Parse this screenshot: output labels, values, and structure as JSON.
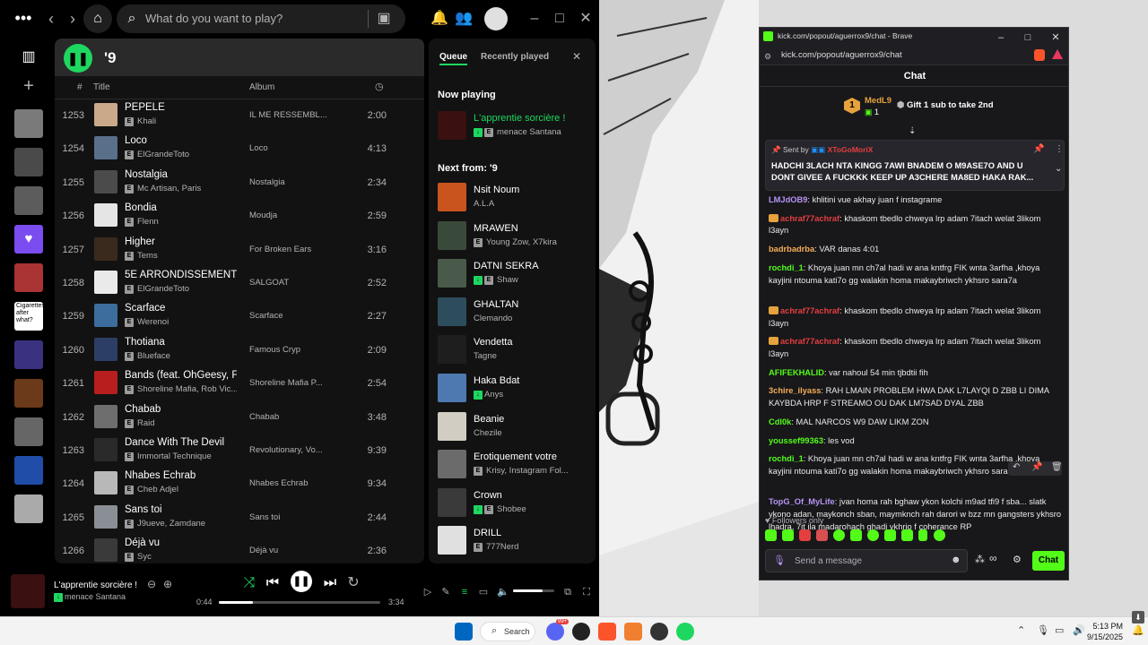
{
  "spotify": {
    "search_placeholder": "What do you want to play?",
    "playlist_title": "'9",
    "columns": {
      "num": "#",
      "title": "Title",
      "album": "Album"
    },
    "library_text_cover": "Cigarettes after what?",
    "tracks": [
      {
        "num": "1253",
        "title": "PEPELE",
        "artist": "Khali",
        "album": "IL ME RESSEMBL...",
        "dur": "2:00",
        "color": "#c9a98a"
      },
      {
        "num": "1254",
        "title": "Loco",
        "artist": "ElGrandeToto",
        "album": "Loco",
        "dur": "4:13",
        "color": "#5a6f8a"
      },
      {
        "num": "1255",
        "title": "Nostalgia",
        "artist": "Mc Artisan, Paris",
        "album": "Nostalgia",
        "dur": "2:34",
        "color": "#4b4b4b"
      },
      {
        "num": "1256",
        "title": "Bondia",
        "artist": "Flenn",
        "album": "Moudja",
        "dur": "2:59",
        "color": "#e5e5e5"
      },
      {
        "num": "1257",
        "title": "Higher",
        "artist": "Tems",
        "album": "For Broken Ears",
        "dur": "3:16",
        "color": "#3a2a1e"
      },
      {
        "num": "1258",
        "title": "5E ARRONDISSEMENT",
        "artist": "ElGrandeToto",
        "album": "SALGOAT",
        "dur": "2:52",
        "color": "#eaeaea"
      },
      {
        "num": "1259",
        "title": "Scarface",
        "artist": "Werenoi",
        "album": "Scarface",
        "dur": "2:27",
        "color": "#3c6d9c"
      },
      {
        "num": "1260",
        "title": "Thotiana",
        "artist": "Blueface",
        "album": "Famous Cryp",
        "dur": "2:09",
        "color": "#2c3e66"
      },
      {
        "num": "1261",
        "title": "Bands (feat. OhGeesy, F...",
        "artist": "Shoreline Mafia, Rob Vic...",
        "album": "Shoreline Mafia P...",
        "dur": "2:54",
        "color": "#b71f1f"
      },
      {
        "num": "1262",
        "title": "Chabab",
        "artist": "Raid",
        "album": "Chabab",
        "dur": "3:48",
        "color": "#6e6e6e"
      },
      {
        "num": "1263",
        "title": "Dance With The Devil",
        "artist": "Immortal Technique",
        "album": "Revolutionary, Vo...",
        "dur": "9:39",
        "color": "#2a2a2a"
      },
      {
        "num": "1264",
        "title": "Nhabes Echrab",
        "artist": "Cheb Adjel",
        "album": "Nhabes Echrab",
        "dur": "9:34",
        "color": "#b8b8b8"
      },
      {
        "num": "1265",
        "title": "Sans toi",
        "artist": "J9ueve, Zamdane",
        "album": "Sans toi",
        "dur": "2:44",
        "color": "#8a8f96"
      },
      {
        "num": "1266",
        "title": "Déjà vu",
        "artist": "Syc",
        "album": "Déjà vu",
        "dur": "2:36",
        "color": "#3a3a3a"
      }
    ],
    "queue": {
      "tab_queue": "Queue",
      "tab_recent": "Recently played",
      "now_playing_label": "Now playing",
      "now": {
        "title": "L'apprentie sorcière !",
        "artist": "menace Santana"
      },
      "next_label": "Next from: '9",
      "items": [
        {
          "title": "Nsit Noum",
          "artist": "A.L.A",
          "badge": "",
          "color": "#c9541d"
        },
        {
          "title": "MRAWEN",
          "artist": "Young Zow, X7kira",
          "badge": "E",
          "color": "#3a4a3a"
        },
        {
          "title": "DATNI SEKRA",
          "artist": "Shaw",
          "badge": "GE",
          "color": "#4a5a4a"
        },
        {
          "title": "GHALTAN",
          "artist": "Clemando",
          "badge": "",
          "color": "#2d4d5d"
        },
        {
          "title": "Vendetta",
          "artist": "Tagne",
          "badge": "",
          "color": "#1e1e1e"
        },
        {
          "title": "Haka Bdat",
          "artist": "Anys",
          "badge": "G",
          "color": "#4d79b0"
        },
        {
          "title": "Beanie",
          "artist": "Chezile",
          "badge": "",
          "color": "#d2cdc2"
        },
        {
          "title": "Erotiquement votre",
          "artist": "Krisy, Instagram Fol...",
          "badge": "E",
          "color": "#6b6b6b"
        },
        {
          "title": "Crown",
          "artist": "Shobee",
          "badge": "GE",
          "color": "#3a3a3a"
        },
        {
          "title": "DRILL",
          "artist": "777Nerd",
          "badge": "E",
          "color": "#e0e0e0"
        }
      ]
    },
    "player": {
      "title": "L'apprentie sorcière !",
      "artist": "menace Santana",
      "elapsed": "0:44",
      "total": "3:34",
      "progress": 0.21,
      "volume": 0.72
    }
  },
  "kick": {
    "window_title": "kick.com/popout/aguerrox9/chat - Brave",
    "url": "kick.com/popout/aguerrox9/chat",
    "chat_header": "Chat",
    "gift": {
      "rank": "1",
      "user": "MedL9",
      "count": "1",
      "label": "Gift 1 sub to take 2nd"
    },
    "pinned": {
      "sent_by": "Sent by",
      "author": "XToGoMoriX",
      "text": "HADCHI 3LACH NTA KINGG 7AWI BNADEM O M9ASE7O AND U DONT GIVEE A FUCKKK KEEP UP A3CHERE MA8ED HAKA RAK..."
    },
    "messages": [
      {
        "user": "LMJdOB9",
        "color": "#b794f4",
        "crown": false,
        "text": "khlitini vue akhay juan f instagrame"
      },
      {
        "user": "achraf77achraf",
        "color": "#e53e3e",
        "crown": true,
        "text": "khaskom tbedlo chweya lrp adam 7itach welat 3likom l3ayn"
      },
      {
        "user": "badrbadrba",
        "color": "#f6ad55",
        "crown": false,
        "text": "VAR danas 4:01"
      },
      {
        "user": "rochdi_1",
        "color": "#53fc18",
        "crown": false,
        "text": "Khoya juan mn ch7al hadi w ana kntfrg FIK wnta 3arfha ,khoya kayjini ntouma kati7o gg walakin homa makaybriwch ykhsro sara7a"
      },
      {
        "user": "achraf77achraf",
        "color": "#e53e3e",
        "crown": true,
        "text": "khaskom tbedlo chweya lrp adam 7itach welat 3likom l3ayn"
      },
      {
        "user": "achraf77achraf",
        "color": "#e53e3e",
        "crown": true,
        "text": "khaskom tbedlo chweya lrp adam 7itach welat 3likom l3ayn"
      },
      {
        "user": "AFIFEKHALID",
        "color": "#53fc18",
        "crown": false,
        "text": "var nahoul 54 min tjbdtii fih"
      },
      {
        "user": "3chire_ilyass",
        "color": "#f6ad55",
        "crown": false,
        "text": "RAH LMAIN PROBLEM HWA DAK L7LAYQI D ZBB LI DIMA KAYBDA HRP F STREAMO OU DAK LM7SAD DYAL ZBB"
      },
      {
        "user": "Cdl0k",
        "color": "#53fc18",
        "crown": false,
        "text": "MAL NARCOS W9 DAW LIKM ZON"
      },
      {
        "user": "youssef99363",
        "color": "#53fc18",
        "crown": false,
        "text": "les vod"
      },
      {
        "user": "rochdi_1",
        "color": "#53fc18",
        "crown": false,
        "text": "Khoya juan mn ch7al hadi w ana kntfrg FIK wnta 3arfha ,khoya kayjini ntouma kati7o gg walakin homa makaybriwch ykhsro sara7a"
      },
      {
        "user": "TopG_Of_MyLife",
        "color": "#b794f4",
        "crown": false,
        "text": "jvan homa rah bghaw ykon kolchi m9ad tfi9 f sba... slatk ykono adan, maykonch sban, maymknch rah darori w bzz mn gangsters ykhsro lhadra, 7it ila madarohach ghadi ykhrjo f coherance RP"
      }
    ],
    "followers_only": "Followers only",
    "input_placeholder": "Send a message",
    "send_label": "Chat"
  },
  "taskbar": {
    "search_label": "Search",
    "time": "5:13 PM",
    "date": "9/15/2025",
    "badge_count": "99+"
  }
}
